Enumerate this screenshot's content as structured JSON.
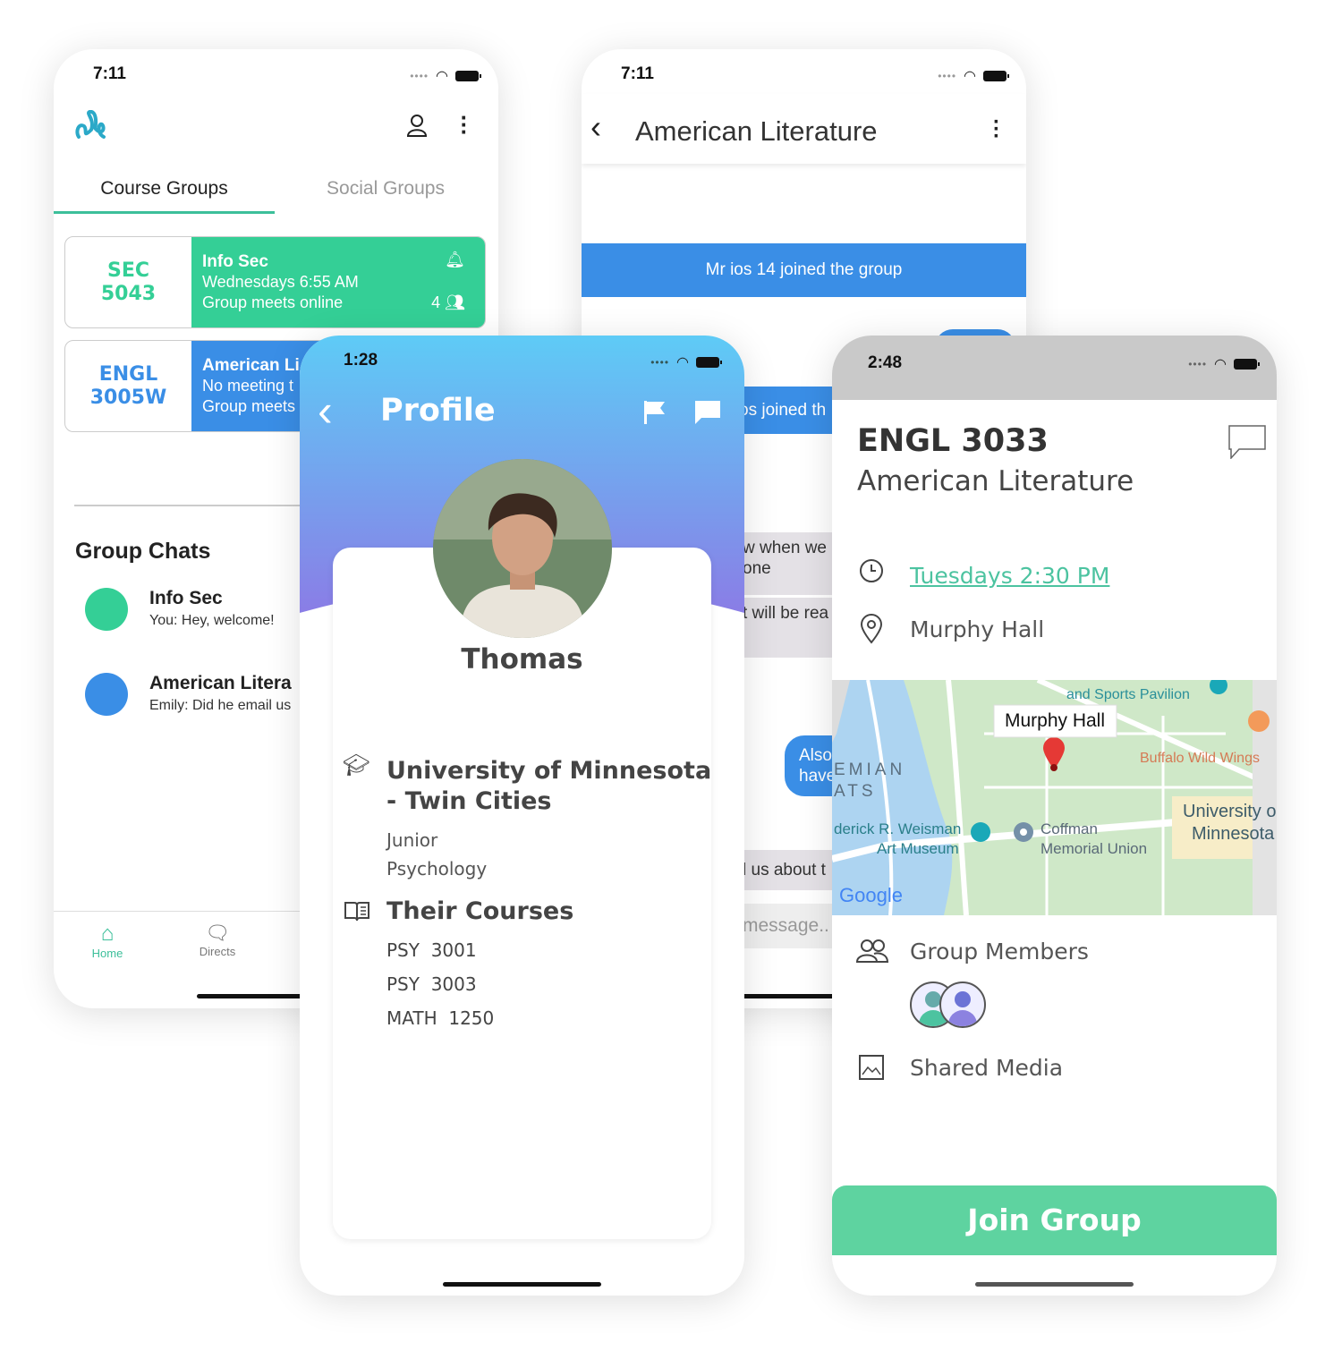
{
  "home_screen": {
    "time": "7:11",
    "tabs": [
      {
        "label": "Course Groups",
        "active": true
      },
      {
        "label": "Social Groups",
        "active": false
      }
    ],
    "course_cards": [
      {
        "code_line1": "SEC",
        "code_line2": "5043",
        "title": "Info Sec",
        "schedule": "Wednesdays 6:55 AM",
        "location": "Group meets online",
        "members": "4",
        "color": "#34cf96",
        "icon": "bell-icon"
      },
      {
        "code_line1": "ENGL",
        "code_line2": "3005W",
        "title": "American Li",
        "schedule": "No meeting t",
        "location": "Group meets",
        "color": "#3a8ee6"
      }
    ],
    "group_chats_title": "Group Chats",
    "chats": [
      {
        "name": "Info Sec",
        "preview": "You:  Hey, welcome!",
        "color": "#34cf96"
      },
      {
        "name": "American Litera",
        "preview": "Emily: Did he email us",
        "color": "#3a8ee6"
      }
    ],
    "nav": [
      {
        "label": "Home",
        "icon": "home-icon",
        "active": true
      },
      {
        "label": "Directs",
        "icon": "chat-icon"
      }
    ]
  },
  "chat_screen": {
    "time": "7:11",
    "title": "American Literature",
    "system_message": "Mr ios 14 joined the group",
    "system_message_2": "os joined th",
    "messages": [
      {
        "line1": "w when we",
        "line2": "one",
        "side": "left"
      },
      {
        "line1": "t will be rea",
        "side": "left"
      },
      {
        "line1": "Also",
        "line2": "have",
        "side": "right"
      },
      {
        "line1": "l us about t",
        "side": "left"
      }
    ],
    "input_placeholder": "message.."
  },
  "profile_screen": {
    "time": "1:28",
    "title": "Profile",
    "name": "Thomas",
    "university_line1": "University of Minnesota",
    "university_line2": "- Twin Cities",
    "year": "Junior",
    "major": "Psychology",
    "courses_title": "Their Courses",
    "courses": [
      "PSY  3001",
      "PSY  3003",
      "MATH  1250"
    ],
    "gradient": [
      "#5ecbf6",
      "#8a7de6"
    ]
  },
  "group_screen": {
    "time": "2:48",
    "code": "ENGL 3033",
    "name": "American Literature",
    "schedule": "Tuesdays 2:30 PM",
    "location": "Murphy Hall",
    "map": {
      "pin_label": "Murphy Hall",
      "labels": [
        "and Sports Pavilion",
        "Buffalo Wild Wings",
        "University o",
        "Minnesota",
        "Coffman",
        "Memorial Union",
        "derick R. Weisman",
        "Art Museum",
        "EMIAN",
        "ATS",
        "Google"
      ]
    },
    "members_label": "Group Members",
    "media_label": "Shared Media",
    "join_button": "Join Group",
    "accent": "#5ed3a0"
  }
}
